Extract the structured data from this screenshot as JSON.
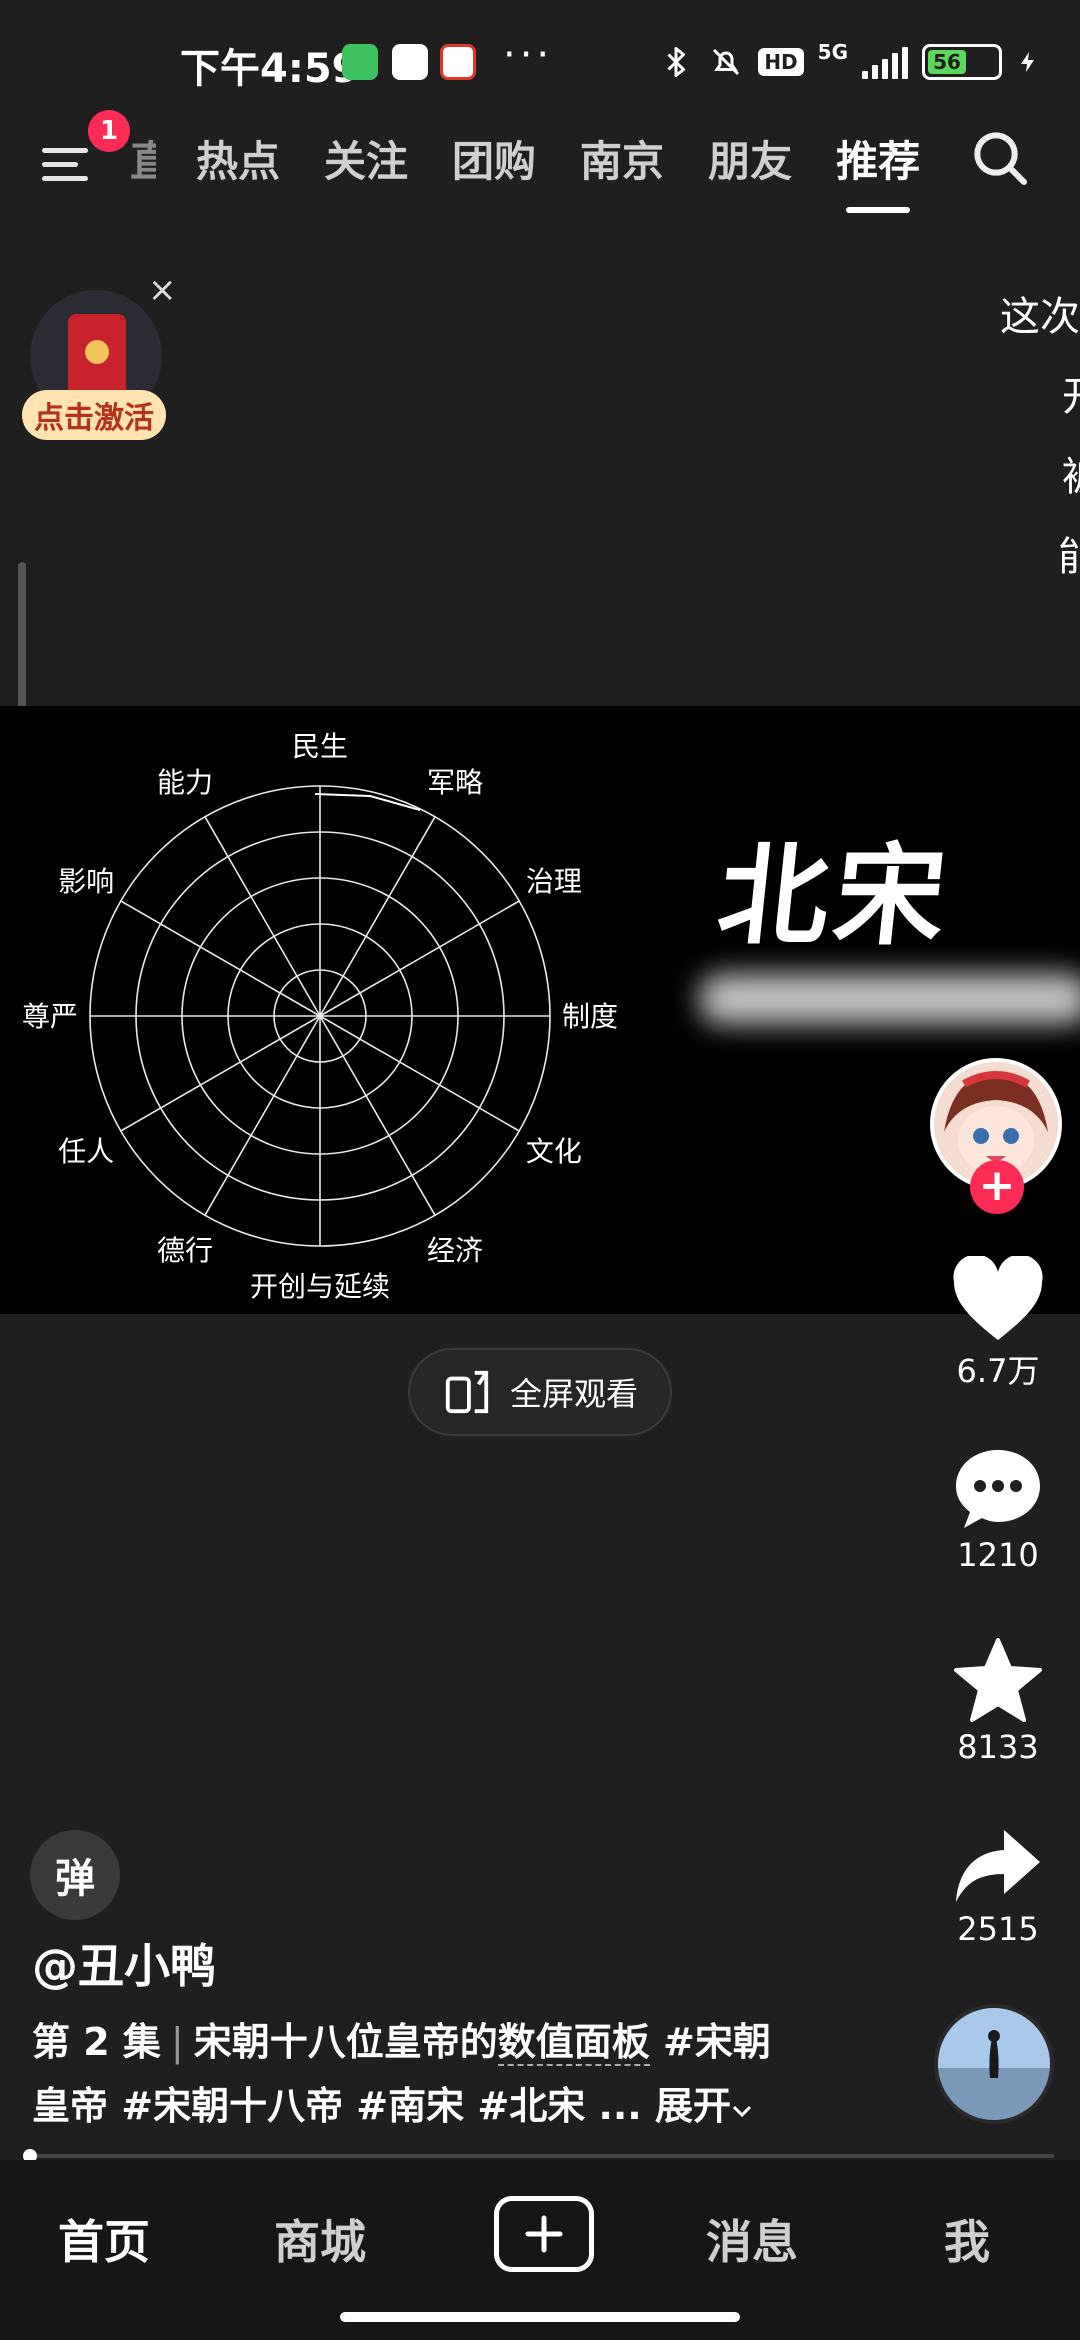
{
  "status_bar": {
    "time": "下午4:59",
    "more": "···",
    "hd": "HD",
    "network": "5G",
    "battery_level": "56",
    "battery_fraction": 0.56
  },
  "top_nav": {
    "badge_count": "1",
    "clipped_tab": "直播",
    "tabs": [
      {
        "label": "热点"
      },
      {
        "label": "关注"
      },
      {
        "label": "团购"
      },
      {
        "label": "南京"
      },
      {
        "label": "朋友"
      },
      {
        "label": "推荐",
        "active": true
      }
    ]
  },
  "redpacket": {
    "label": "点击激活",
    "close": "×"
  },
  "edge_text": [
    "这次",
    "开",
    "被",
    "能"
  ],
  "video": {
    "title": "北宋",
    "radar_labels": [
      "民生",
      "军略",
      "治理",
      "制度",
      "文化",
      "经济",
      "开创与延续",
      "德行",
      "任人",
      "尊严",
      "影响",
      "能力"
    ]
  },
  "actions": {
    "like_count": "6.7万",
    "comment_count": "1210",
    "favorite_count": "8133",
    "share_count": "2515"
  },
  "fullscreen": {
    "label": "全屏观看"
  },
  "danmaku": {
    "label": "弹"
  },
  "post": {
    "author": "@丑小鸭",
    "episode": "第 2 集",
    "separator": "|",
    "text_before": "宋朝十八位皇帝的",
    "keyword": "数值面板",
    "tags_line1": "#宋朝",
    "tags_line2": "皇帝 #宋朝十八帝 #南宋 #北宋 ...",
    "expand": "展开"
  },
  "progress": {
    "fraction": 0.0
  },
  "tab_bar": {
    "home": "首页",
    "mall": "商城",
    "messages": "消息",
    "me": "我"
  }
}
